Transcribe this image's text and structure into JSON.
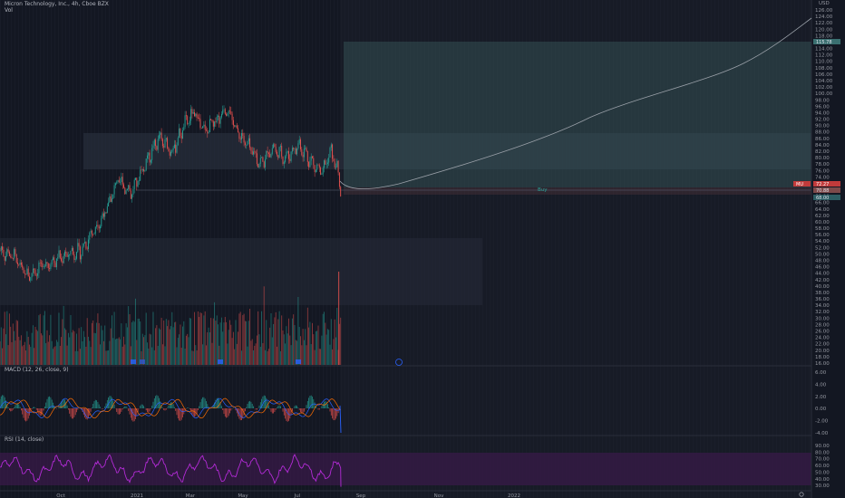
{
  "header": {
    "symbol_title": "Micron Technology, Inc., 4h, Cboe BZX",
    "volume_label": "Vol"
  },
  "price_axis": {
    "currency": "USD",
    "ticks": [
      "126.00",
      "124.00",
      "122.00",
      "120.00",
      "118.00",
      "116.00",
      "114.00",
      "112.00",
      "110.00",
      "108.00",
      "106.00",
      "104.00",
      "102.00",
      "100.00",
      "98.00",
      "96.00",
      "94.00",
      "92.00",
      "90.00",
      "88.00",
      "86.00",
      "84.00",
      "82.00",
      "80.00",
      "78.00",
      "76.00",
      "74.00",
      "72.00",
      "70.00",
      "68.00",
      "66.00",
      "64.00",
      "62.00",
      "60.00",
      "58.00",
      "56.00",
      "54.00",
      "52.00",
      "50.00",
      "48.00",
      "46.00",
      "44.00",
      "42.00",
      "40.00",
      "38.00",
      "36.00",
      "34.00",
      "32.00",
      "30.00",
      "28.00",
      "26.00",
      "24.00",
      "22.00",
      "20.00",
      "18.00",
      "16.00"
    ],
    "target_price_badge": "115.78",
    "current_price_badge": "72.27",
    "stop_badge": "70.88",
    "ticker_badge": "MU",
    "lower_badge": "68.00"
  },
  "macd": {
    "label": "MACD (12, 26, close, 9)",
    "ticks": [
      "6.00",
      "4.00",
      "2.00",
      "0.00",
      "-2.00",
      "-4.00"
    ]
  },
  "rsi": {
    "label": "RSI (14, close)",
    "ticks": [
      "90.00",
      "80.00",
      "70.00",
      "60.00",
      "50.00",
      "40.00",
      "30.00"
    ]
  },
  "time_axis": {
    "labels": [
      "Oct",
      "2021",
      "Mar",
      "May",
      "Jul",
      "Sep",
      "Nov",
      "2022"
    ],
    "settings_icon": "gear-icon"
  },
  "annotations": {
    "buy_label": "Buy"
  },
  "colors": {
    "background": "#131722",
    "up": "#26a69a",
    "down": "#ef5350",
    "rsi": "#b32bd6",
    "target_zone": "#3a5a5e",
    "accent": "#2962ff"
  }
}
